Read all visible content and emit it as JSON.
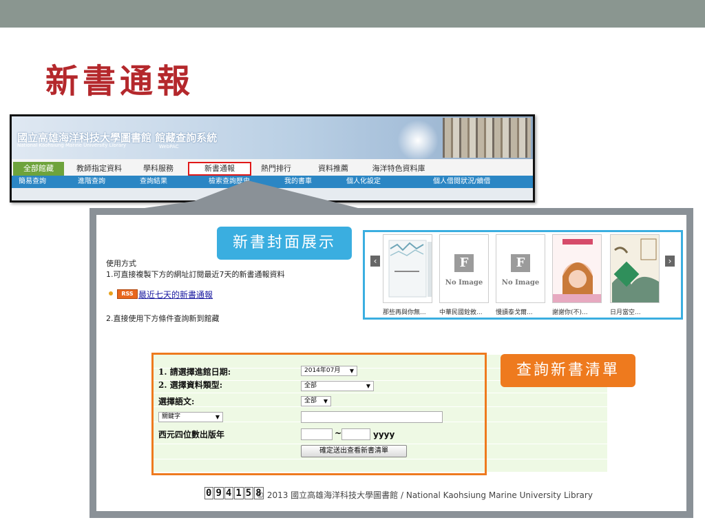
{
  "slide": {
    "title": "新書通報"
  },
  "header": {
    "library_title": "國立高雄海洋科技大學圖書館 館藏查詢系統",
    "library_subtitle": "National Kaohsiung Marine University Library",
    "webpac": "WebPAC",
    "tabs": [
      {
        "label": "全部館藏"
      },
      {
        "label": "教師指定資料"
      },
      {
        "label": "學科服務"
      },
      {
        "label": "新書通報"
      },
      {
        "label": "熱門排行"
      },
      {
        "label": "資料推薦"
      },
      {
        "label": "海洋特色資料庫"
      }
    ],
    "subnav": [
      {
        "label": "簡易查詢"
      },
      {
        "label": "進階查詢"
      },
      {
        "label": "查詢結果"
      },
      {
        "label": "檢索查詢歷史"
      },
      {
        "label": "我的書車"
      },
      {
        "label": "個人化設定"
      },
      {
        "label": "個人借閱狀況/續借"
      }
    ]
  },
  "callouts": {
    "cover_display": "新書封面展示",
    "query_list": "查詢新書清單"
  },
  "usage": {
    "heading": "使用方式",
    "step1": "1.可直接複製下方的網址訂閱最近7天的新書通報資料",
    "rss_badge": "RSS",
    "rss_link": "最近七天的新書通報",
    "step2": "2.直接使用下方條件查詢新到館藏"
  },
  "carousel": {
    "prev": "‹",
    "next": "›",
    "books": [
      {
        "title": "那些再與你無..."
      },
      {
        "title": "中華民國銓敘...",
        "placeholder": "No Image"
      },
      {
        "title": "慢讀泰戈爾...",
        "placeholder": "No Image"
      },
      {
        "title": "謝謝你(不)..."
      },
      {
        "title": "日月當空..."
      }
    ]
  },
  "form": {
    "date_label": "1. 請選擇進館日期:",
    "date_value": "2014年07月",
    "type_label": "2. 選擇資料類型:",
    "type_value": "全部",
    "lang_label": "選擇語文:",
    "lang_value": "全部",
    "keyword_type": "關鍵字",
    "keyword_value": "",
    "year_label": "西元四位數出版年",
    "year_from": "",
    "tilde": "~",
    "year_to": "",
    "yyyy": "yyyy",
    "submit": "確定送出查看新書清單"
  },
  "footer": {
    "counter": "094158",
    "copyright": "© 2013 國立高雄海洋科技大學圖書館 / National Kaohsiung Marine University Library"
  },
  "colors": {
    "title_red": "#b4282c",
    "callout_blue": "#3aaee0",
    "callout_orange": "#ee7a1e",
    "nav_blue": "#2b86c4",
    "tab_green": "#6ea33c"
  }
}
